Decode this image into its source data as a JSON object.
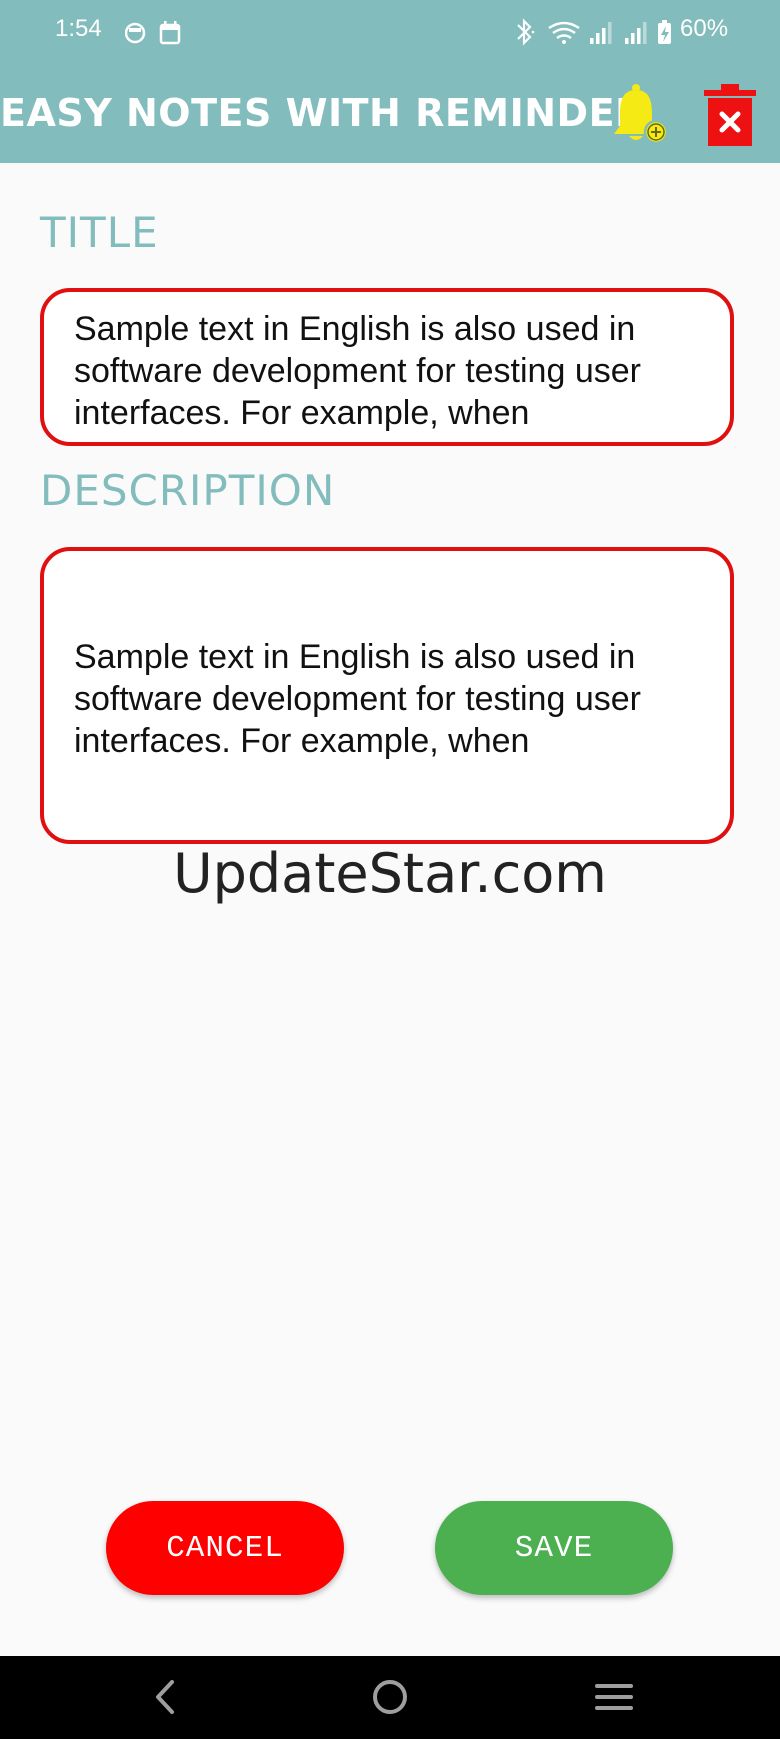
{
  "status_bar": {
    "time": "1:54",
    "battery": "60%",
    "icons": [
      "face-icon",
      "calendar-icon",
      "bluetooth-icon",
      "wifi-icon",
      "signal-icon",
      "signal-icon",
      "battery-charging-icon"
    ]
  },
  "app_bar": {
    "title": "EASY NOTES WITH REMINDER",
    "actions": [
      "add-reminder-bell-icon",
      "delete-trash-icon"
    ]
  },
  "form": {
    "title_label": "TITLE",
    "title_value": "Sample text in English is also used in software development for testing user interfaces. For example, when",
    "description_label": "DESCRIPTION",
    "description_value": "Sample text in English is also used in software development for testing user interfaces. For example, when"
  },
  "watermark": "UpdateStar.com",
  "buttons": {
    "cancel": "CANCEL",
    "save": "SAVE"
  },
  "colors": {
    "primary": "#82bcbc",
    "field_border": "#e01010",
    "cancel": "#ff0000",
    "save": "#4caf50",
    "bell": "#f5ea14",
    "delete": "#ee1111"
  },
  "nav_bar": [
    "back-icon",
    "home-icon",
    "recents-icon"
  ]
}
